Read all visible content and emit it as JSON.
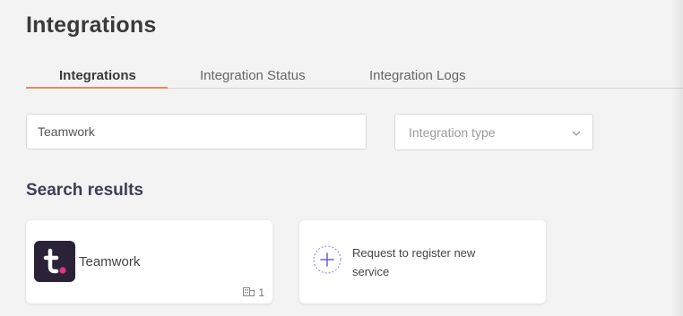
{
  "page": {
    "title": "Integrations"
  },
  "tabs": [
    {
      "label": "Integrations",
      "active": true
    },
    {
      "label": "Integration Status",
      "active": false
    },
    {
      "label": "Integration Logs",
      "active": false
    }
  ],
  "filters": {
    "search_value": "Teamwork",
    "type_placeholder": "Integration type"
  },
  "results": {
    "title": "Search results",
    "cards": [
      {
        "name": "Teamwork",
        "count": "1",
        "logo_icon": "teamwork-logo-icon",
        "org_icon": "building-icon"
      }
    ],
    "request_card": {
      "label": "Request to register new service",
      "icon": "plus-icon"
    }
  },
  "colors": {
    "accent": "#e88a58",
    "logo_bg": "#2b2238",
    "logo_dot": "#e0338a",
    "plus": "#6b5fd6"
  }
}
